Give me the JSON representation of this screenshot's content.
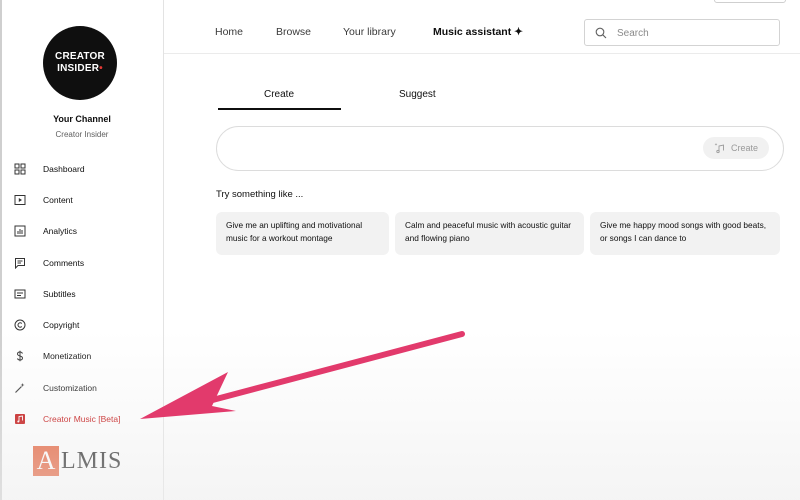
{
  "sidebar": {
    "logo_line1": "CREATOR",
    "logo_line2": "INSIDER",
    "logo_dot": "•",
    "channel_title": "Your Channel",
    "channel_name": "Creator Insider",
    "items": [
      {
        "label": "Dashboard",
        "icon": "dashboard-icon"
      },
      {
        "label": "Content",
        "icon": "content-icon"
      },
      {
        "label": "Analytics",
        "icon": "analytics-icon"
      },
      {
        "label": "Comments",
        "icon": "comments-icon"
      },
      {
        "label": "Subtitles",
        "icon": "subtitles-icon"
      },
      {
        "label": "Copyright",
        "icon": "copyright-icon"
      },
      {
        "label": "Monetization",
        "icon": "monetization-icon"
      },
      {
        "label": "Customization",
        "icon": "customization-icon"
      },
      {
        "label": "Creator Music [Beta]",
        "icon": "creator-music-icon",
        "active": true
      }
    ],
    "watermark_a": "A",
    "watermark_rest": "LMIS"
  },
  "topbar": {
    "nav": [
      "Home",
      "Browse",
      "Your library",
      "Music assistant ✦"
    ],
    "search_placeholder": "Search",
    "search_value": ""
  },
  "main": {
    "tabs": [
      "Create",
      "Suggest"
    ],
    "active_tab": "Create",
    "prompt_value": "",
    "create_button": "Create",
    "try_label": "Try something like ...",
    "suggestions": [
      "Give me an uplifting and motivational music for a workout montage",
      "Calm and peaceful music with acoustic guitar and flowing piano",
      "Give me happy mood songs with good beats, or songs I can dance to"
    ]
  },
  "colors": {
    "accent_red": "#c00000",
    "arrow": "#e23a6c",
    "watermark_orange": "#e4572e"
  }
}
